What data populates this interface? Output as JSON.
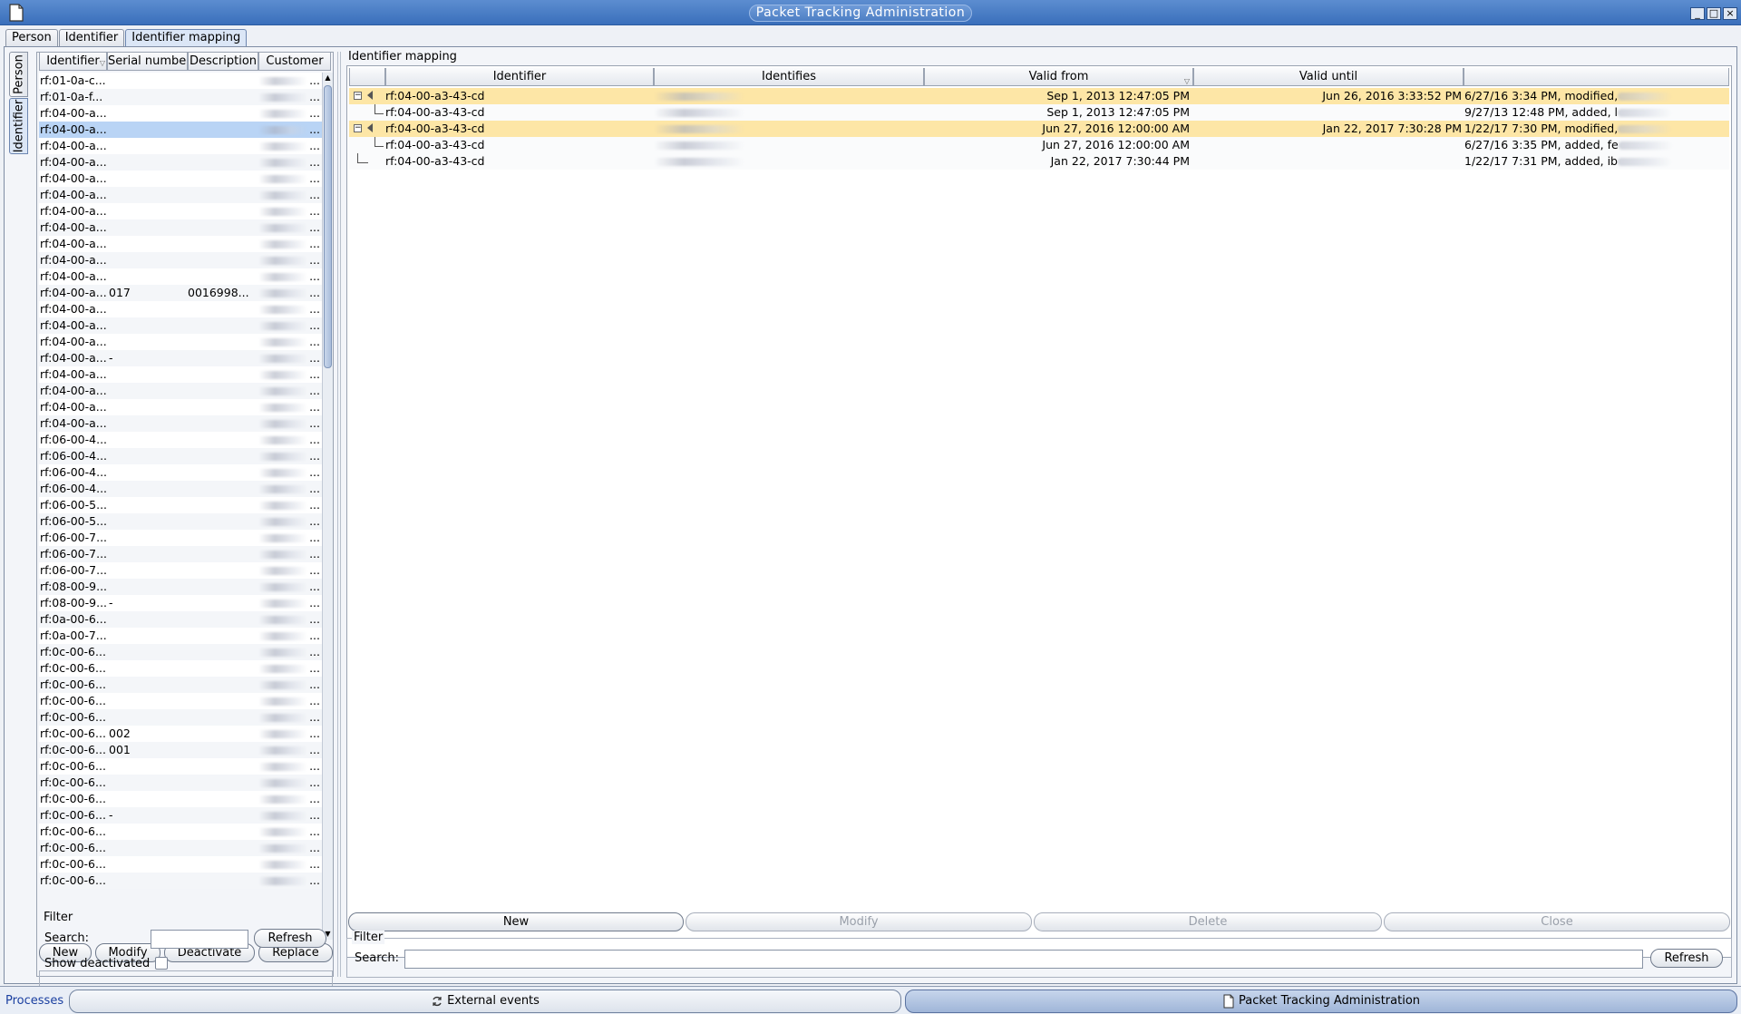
{
  "window": {
    "title": "Packet Tracking Administration",
    "minimize": "_",
    "maximize": "□",
    "close": "×"
  },
  "tabs": [
    "Person",
    "Identifier",
    "Identifier mapping"
  ],
  "side_tabs": [
    "Person",
    "Identifier"
  ],
  "left": {
    "columns": [
      "Identifier",
      "Serial number",
      "Description",
      "Customer"
    ],
    "rows": [
      {
        "id": "rf:01-0a-c...",
        "sn": "",
        "desc": ""
      },
      {
        "id": "rf:01-0a-f...",
        "sn": "",
        "desc": ""
      },
      {
        "id": "rf:04-00-a...",
        "sn": "",
        "desc": ""
      },
      {
        "id": "rf:04-00-a...",
        "sn": "",
        "desc": ""
      },
      {
        "id": "rf:04-00-a...",
        "sn": "",
        "desc": ""
      },
      {
        "id": "rf:04-00-a...",
        "sn": "",
        "desc": ""
      },
      {
        "id": "rf:04-00-a...",
        "sn": "",
        "desc": ""
      },
      {
        "id": "rf:04-00-a...",
        "sn": "",
        "desc": ""
      },
      {
        "id": "rf:04-00-a...",
        "sn": "",
        "desc": ""
      },
      {
        "id": "rf:04-00-a...",
        "sn": "",
        "desc": ""
      },
      {
        "id": "rf:04-00-a...",
        "sn": "",
        "desc": ""
      },
      {
        "id": "rf:04-00-a...",
        "sn": "",
        "desc": ""
      },
      {
        "id": "rf:04-00-a...",
        "sn": "",
        "desc": ""
      },
      {
        "id": "rf:04-00-a...",
        "sn": "017",
        "desc": "0016998..."
      },
      {
        "id": "rf:04-00-a...",
        "sn": "",
        "desc": ""
      },
      {
        "id": "rf:04-00-a...",
        "sn": "",
        "desc": ""
      },
      {
        "id": "rf:04-00-a...",
        "sn": "",
        "desc": ""
      },
      {
        "id": "rf:04-00-a...",
        "sn": "-",
        "desc": ""
      },
      {
        "id": "rf:04-00-a...",
        "sn": "",
        "desc": ""
      },
      {
        "id": "rf:04-00-a...",
        "sn": "",
        "desc": ""
      },
      {
        "id": "rf:04-00-a...",
        "sn": "",
        "desc": ""
      },
      {
        "id": "rf:04-00-a...",
        "sn": "",
        "desc": ""
      },
      {
        "id": "rf:06-00-4...",
        "sn": "",
        "desc": ""
      },
      {
        "id": "rf:06-00-4...",
        "sn": "",
        "desc": ""
      },
      {
        "id": "rf:06-00-4...",
        "sn": "",
        "desc": ""
      },
      {
        "id": "rf:06-00-4...",
        "sn": "",
        "desc": ""
      },
      {
        "id": "rf:06-00-5...",
        "sn": "",
        "desc": ""
      },
      {
        "id": "rf:06-00-5...",
        "sn": "",
        "desc": ""
      },
      {
        "id": "rf:06-00-7...",
        "sn": "",
        "desc": ""
      },
      {
        "id": "rf:06-00-7...",
        "sn": "",
        "desc": ""
      },
      {
        "id": "rf:06-00-7...",
        "sn": "",
        "desc": ""
      },
      {
        "id": "rf:08-00-9...",
        "sn": "",
        "desc": ""
      },
      {
        "id": "rf:08-00-9...",
        "sn": "-",
        "desc": ""
      },
      {
        "id": "rf:0a-00-6...",
        "sn": "",
        "desc": ""
      },
      {
        "id": "rf:0a-00-7...",
        "sn": "",
        "desc": ""
      },
      {
        "id": "rf:0c-00-6...",
        "sn": "",
        "desc": ""
      },
      {
        "id": "rf:0c-00-6...",
        "sn": "",
        "desc": ""
      },
      {
        "id": "rf:0c-00-6...",
        "sn": "",
        "desc": ""
      },
      {
        "id": "rf:0c-00-6...",
        "sn": "",
        "desc": ""
      },
      {
        "id": "rf:0c-00-6...",
        "sn": "",
        "desc": ""
      },
      {
        "id": "rf:0c-00-6...",
        "sn": "002",
        "desc": ""
      },
      {
        "id": "rf:0c-00-6...",
        "sn": "001",
        "desc": ""
      },
      {
        "id": "rf:0c-00-6...",
        "sn": "",
        "desc": ""
      },
      {
        "id": "rf:0c-00-6...",
        "sn": "",
        "desc": ""
      },
      {
        "id": "rf:0c-00-6...",
        "sn": "",
        "desc": ""
      },
      {
        "id": "rf:0c-00-6...",
        "sn": "-",
        "desc": ""
      },
      {
        "id": "rf:0c-00-6...",
        "sn": "",
        "desc": ""
      },
      {
        "id": "rf:0c-00-6...",
        "sn": "",
        "desc": ""
      },
      {
        "id": "rf:0c-00-6...",
        "sn": "",
        "desc": ""
      },
      {
        "id": "rf:0c-00-6...",
        "sn": "",
        "desc": ""
      }
    ],
    "selected_row": 3,
    "ellipsis": "...",
    "buttons": {
      "new": "New",
      "modify": "Modify",
      "deactivate": "Deactivate",
      "replace": "Replace"
    },
    "filter": {
      "legend": "Filter",
      "search_label": "Search:",
      "search_value": "",
      "refresh": "Refresh",
      "show_deactivated": "Show deactivated",
      "show_deactivated_checked": false
    }
  },
  "right": {
    "title": "Identifier mapping",
    "columns": [
      "",
      "Identifier",
      "Identifies",
      "Valid from",
      "Valid until",
      ""
    ],
    "rows": [
      {
        "level": "parent",
        "identifier": "rf:04-00-a3-43-cd",
        "valid_from": "Sep 1, 2013 12:47:05 PM",
        "valid_until": "Jun 26, 2016 3:33:52 PM",
        "history": "6/27/16 3:34 PM, modified,"
      },
      {
        "level": "child",
        "identifier": "rf:04-00-a3-43-cd",
        "valid_from": "Sep 1, 2013 12:47:05 PM",
        "valid_until": "",
        "history": "9/27/13 12:48 PM, added, l"
      },
      {
        "level": "parent",
        "identifier": "rf:04-00-a3-43-cd",
        "valid_from": "Jun 27, 2016 12:00:00 AM",
        "valid_until": "Jan 22, 2017 7:30:28 PM",
        "history": "1/22/17 7:30 PM, modified,"
      },
      {
        "level": "child",
        "identifier": "rf:04-00-a3-43-cd",
        "valid_from": "Jun 27, 2016 12:00:00 AM",
        "valid_until": "",
        "history": "6/27/16 3:35 PM, added, fe"
      },
      {
        "level": "root",
        "identifier": "rf:04-00-a3-43-cd",
        "valid_from": "Jan 22, 2017 7:30:44 PM",
        "valid_until": "",
        "history": "1/22/17 7:31 PM, added, ib"
      }
    ],
    "buttons": {
      "new": "New",
      "modify": "Modify",
      "delete": "Delete",
      "close": "Close"
    },
    "filter": {
      "legend": "Filter",
      "search_label": "Search:",
      "search_value": "",
      "refresh": "Refresh"
    }
  },
  "taskbar": {
    "label": "Processes",
    "items": [
      "External events",
      "Packet Tracking Administration"
    ]
  }
}
